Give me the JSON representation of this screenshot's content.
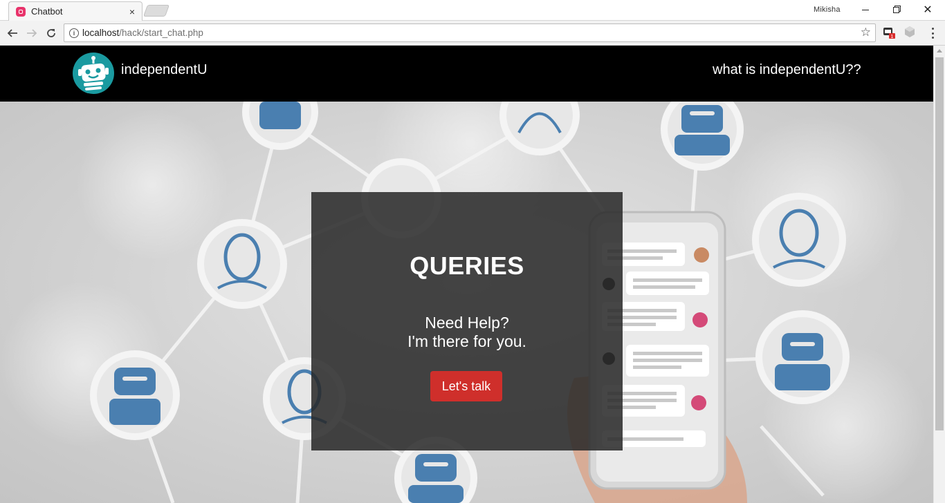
{
  "browser": {
    "tab_title": "Chatbot",
    "tab_close": "×",
    "profile_name": "Mikisha",
    "url_host": "localhost",
    "url_path": "/hack/start_chat.php",
    "info_glyph": "i",
    "star_glyph": "☆",
    "close_glyph": "✕",
    "extension_badge": "1"
  },
  "site": {
    "brand": "independentU",
    "nav_link": "what is independentU??"
  },
  "card": {
    "title": "QUERIES",
    "line1": "Need Help?",
    "line2": "I'm there for you.",
    "button": "Let's talk"
  },
  "colors": {
    "header_bg": "#000000",
    "logo_bg": "#1a9aa0",
    "card_bg": "rgba(40,40,40,0.86)",
    "button_bg": "#cf2f2b",
    "icon_blue": "#4a7fb0"
  }
}
